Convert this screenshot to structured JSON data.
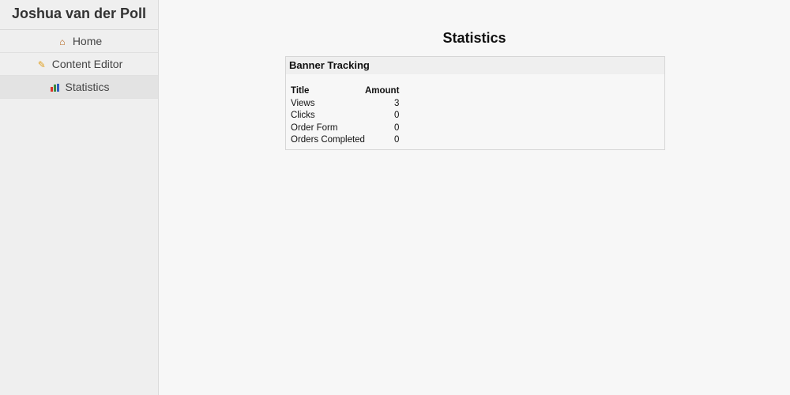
{
  "site": {
    "title": "Joshua van der Poll"
  },
  "nav": {
    "items": [
      {
        "label": "Home",
        "icon": "home-icon",
        "active": false
      },
      {
        "label": "Content Editor",
        "icon": "pencil-icon",
        "active": false
      },
      {
        "label": "Statistics",
        "icon": "bar-chart-icon",
        "active": true
      }
    ]
  },
  "main": {
    "title": "Statistics",
    "panel": {
      "title": "Banner Tracking",
      "columns": [
        "Title",
        "Amount"
      ],
      "rows": [
        {
          "title": "Views",
          "amount": "3"
        },
        {
          "title": "Clicks",
          "amount": "0"
        },
        {
          "title": "Order Form",
          "amount": "0"
        },
        {
          "title": "Orders Completed",
          "amount": "0"
        }
      ]
    }
  },
  "colors": {
    "background": "#f7f7f7",
    "sidebar": "#efefef",
    "active_item": "#e3e3e3",
    "chart_icon_bars": [
      "#d9342b",
      "#3b8a3e",
      "#2f5fbf"
    ]
  }
}
